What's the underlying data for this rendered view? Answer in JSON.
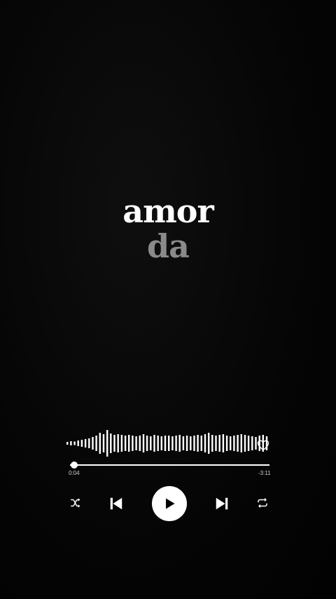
{
  "lyrics": {
    "current_line": "amor",
    "next_line": "da"
  },
  "player": {
    "elapsed": "0:04",
    "remaining": "-3:11",
    "progress_fraction": 0.02,
    "controls": [
      "shuffle-icon",
      "previous-icon",
      "play-icon",
      "next-icon",
      "repeat-icon"
    ],
    "liked_icon": "heart-icon"
  },
  "colors": {
    "background": "#050505",
    "foreground": "#ffffff",
    "secondary_text": "#8a8a8a"
  }
}
